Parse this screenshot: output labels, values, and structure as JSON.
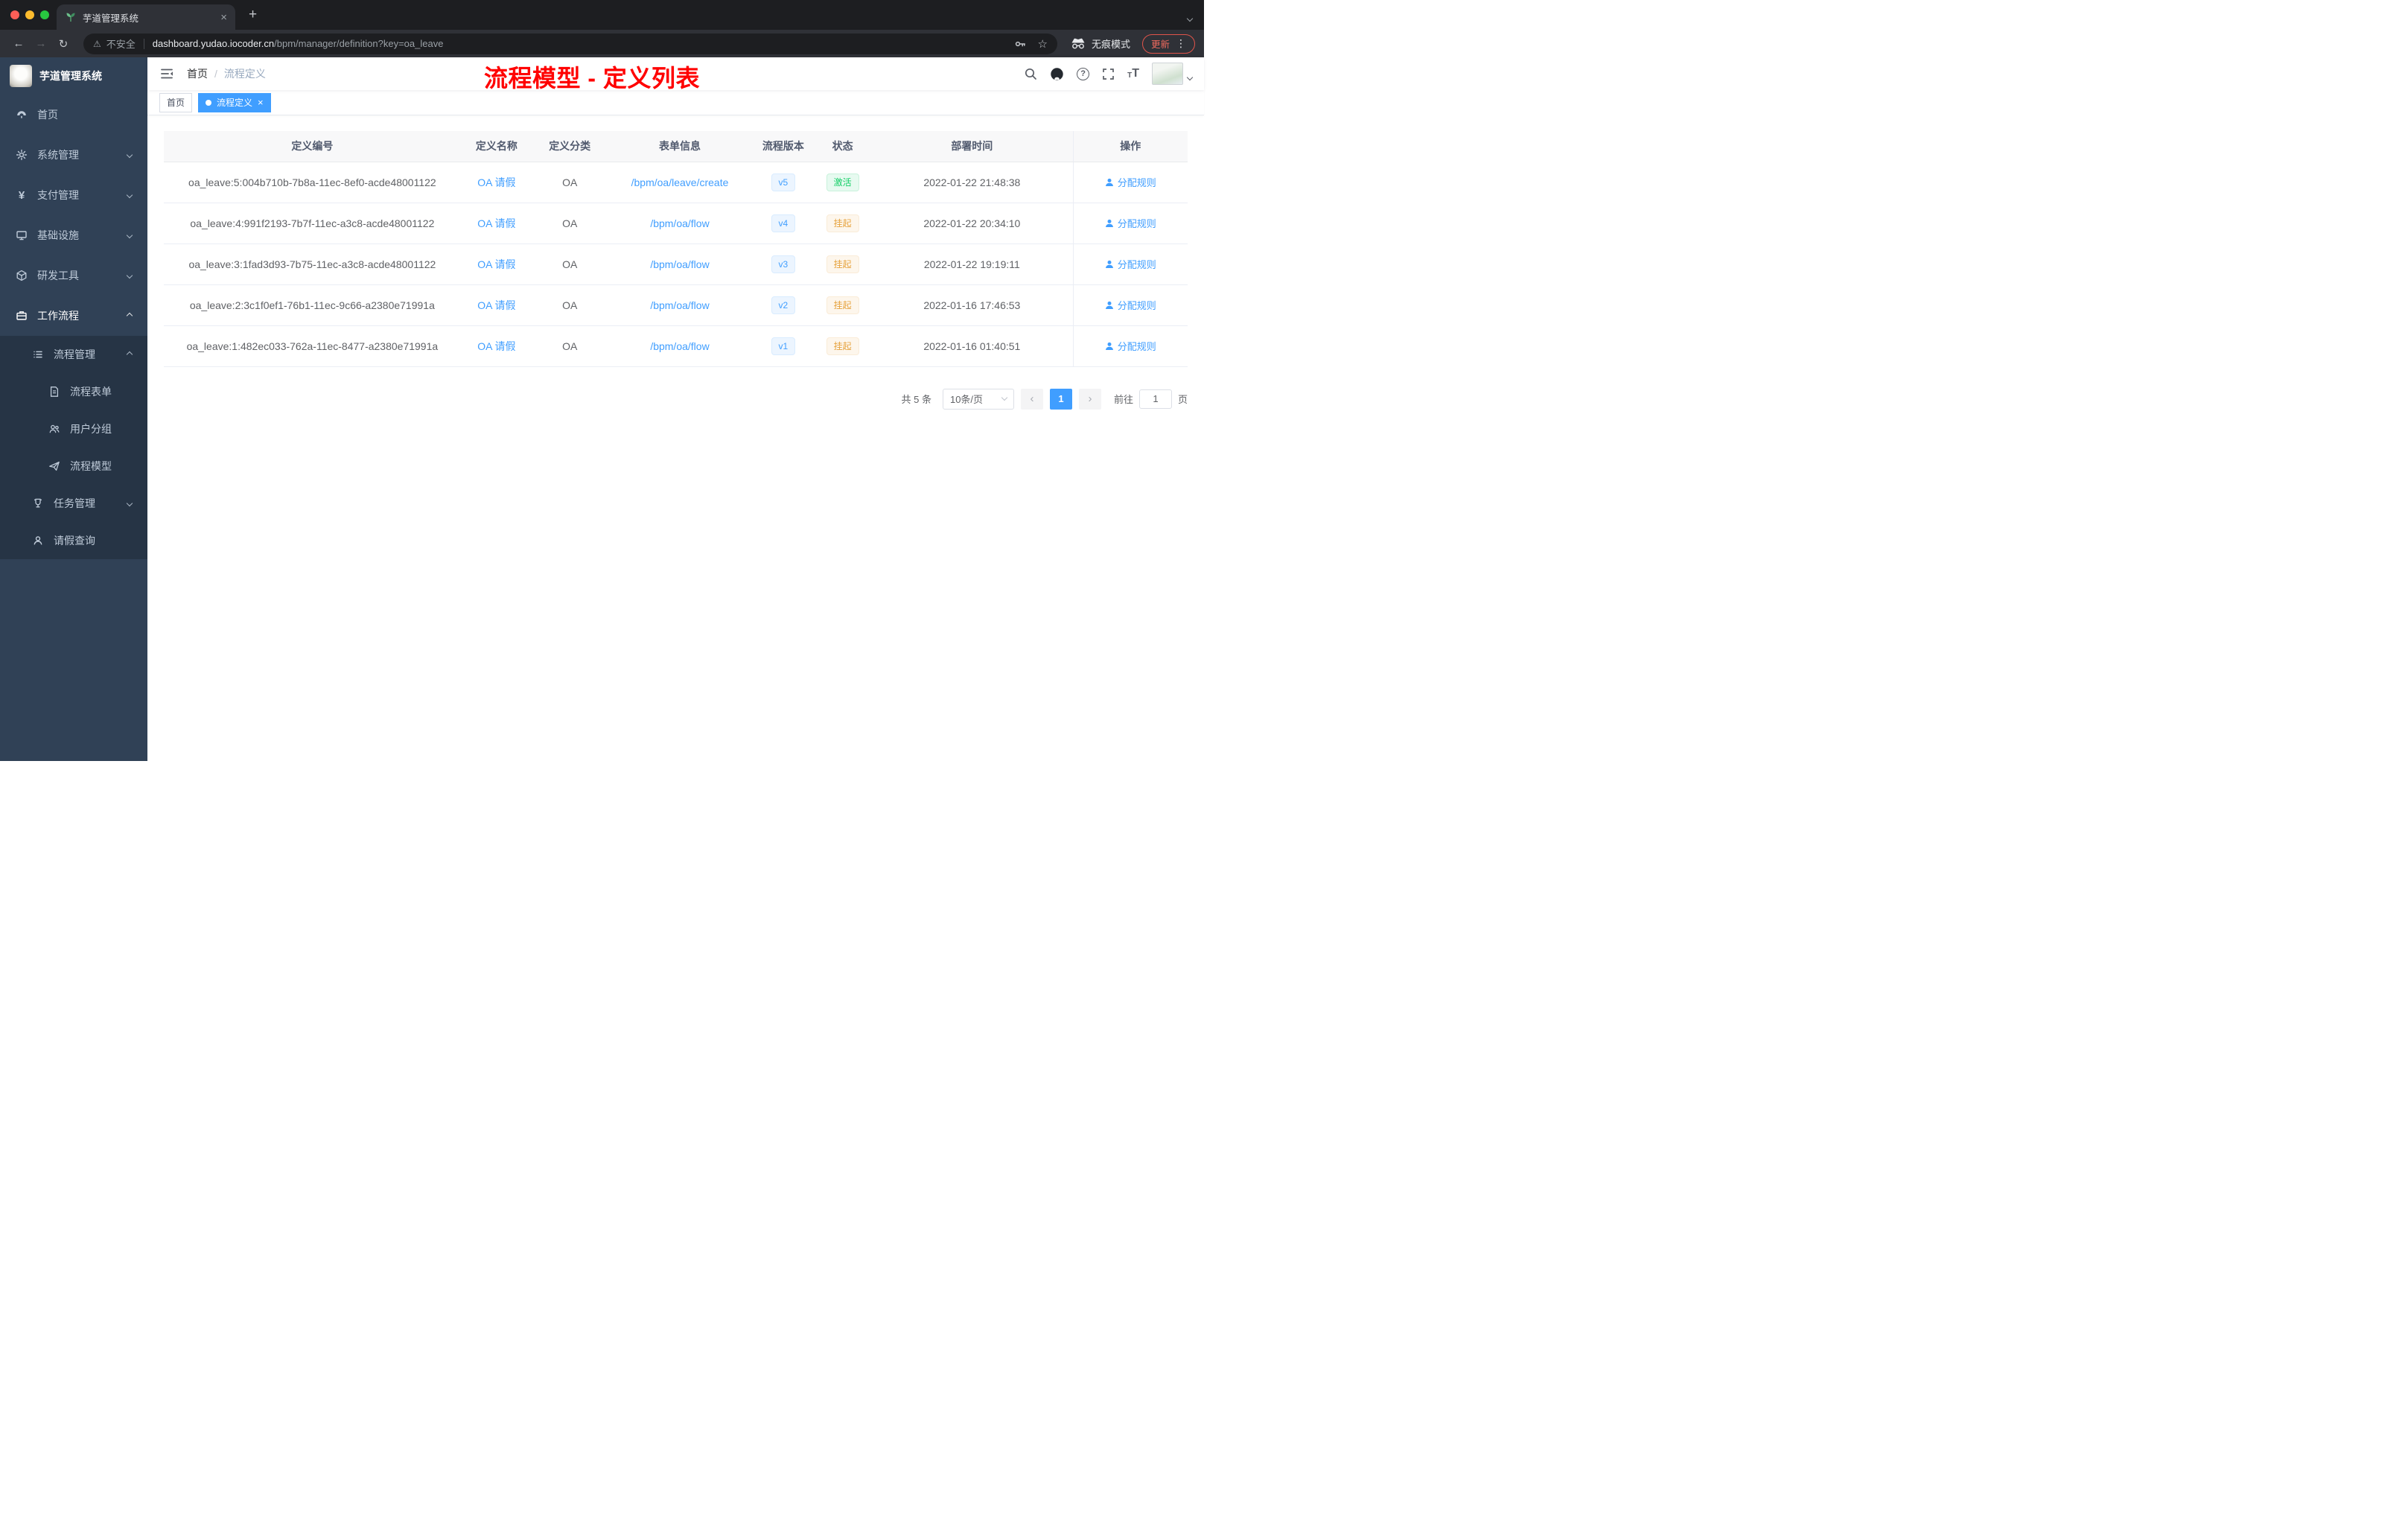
{
  "icons": {
    "close": "×",
    "new_tab": "+",
    "back": "←",
    "forward": "→",
    "reload": "↻",
    "warning": "⚠",
    "star": "☆",
    "more": "⋮",
    "yen": "¥",
    "help": "?",
    "prev": "‹",
    "next": "›",
    "font": "T"
  },
  "browser": {
    "tab_title": "芋道管理系统",
    "security_label": "不安全",
    "url_host": "dashboard.yudao.iocoder.cn",
    "url_path": "/bpm/manager/definition?key=oa_leave",
    "incognito_label": "无痕模式",
    "update_label": "更新"
  },
  "sidebar": {
    "title": "芋道管理系统",
    "menu": [
      "首页",
      "系统管理",
      "支付管理",
      "基础设施",
      "研发工具",
      "工作流程"
    ],
    "submenu": {
      "process_mgmt": "流程管理",
      "process_children": [
        "流程表单",
        "用户分组",
        "流程模型"
      ],
      "task_mgmt": "任务管理",
      "leave_query": "请假查询"
    }
  },
  "header": {
    "breadcrumb_home": "首页",
    "breadcrumb_current": "流程定义",
    "annotation": "流程模型 - 定义列表"
  },
  "tags": {
    "home": "首页",
    "active": "流程定义"
  },
  "table": {
    "columns": [
      "定义编号",
      "定义名称",
      "定义分类",
      "表单信息",
      "流程版本",
      "状态",
      "部署时间",
      "操作"
    ],
    "action_label": "分配规则",
    "rows": [
      {
        "id": "oa_leave:5:004b710b-7b8a-11ec-8ef0-acde48001122",
        "name": "OA 请假",
        "category": "OA",
        "form": "/bpm/oa/leave/create",
        "version": "v5",
        "status": "激活",
        "time": "2022-01-22 21:48:38"
      },
      {
        "id": "oa_leave:4:991f2193-7b7f-11ec-a3c8-acde48001122",
        "name": "OA 请假",
        "category": "OA",
        "form": "/bpm/oa/flow",
        "version": "v4",
        "status": "挂起",
        "time": "2022-01-22 20:34:10"
      },
      {
        "id": "oa_leave:3:1fad3d93-7b75-11ec-a3c8-acde48001122",
        "name": "OA 请假",
        "category": "OA",
        "form": "/bpm/oa/flow",
        "version": "v3",
        "status": "挂起",
        "time": "2022-01-22 19:19:11"
      },
      {
        "id": "oa_leave:2:3c1f0ef1-76b1-11ec-9c66-a2380e71991a",
        "name": "OA 请假",
        "category": "OA",
        "form": "/bpm/oa/flow",
        "version": "v2",
        "status": "挂起",
        "time": "2022-01-16 17:46:53"
      },
      {
        "id": "oa_leave:1:482ec033-762a-11ec-8477-a2380e71991a",
        "name": "OA 请假",
        "category": "OA",
        "form": "/bpm/oa/flow",
        "version": "v1",
        "status": "挂起",
        "time": "2022-01-16 01:40:51"
      }
    ]
  },
  "pagination": {
    "total": "共 5 条",
    "page_size": "10条/页",
    "current_page": "1",
    "goto_label": "前往",
    "goto_value": "1",
    "page_unit": "页"
  },
  "colors": {
    "accent": "#409eff",
    "success_text": "#13ce66",
    "warning_text": "#e6a23c",
    "annotation_red": "#ff0000",
    "sidebar_bg": "#304156",
    "submenu_bg": "#263445"
  }
}
